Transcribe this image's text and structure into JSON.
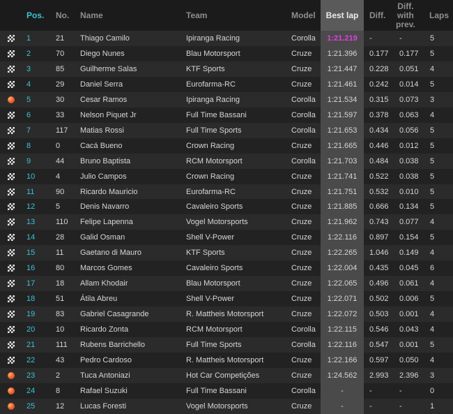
{
  "headers": {
    "pos": "Pos.",
    "no": "No.",
    "name": "Name",
    "team": "Team",
    "model": "Model",
    "best": "Best lap",
    "diff": "Diff.",
    "diffprev": "Diff.\nwith\nprev.",
    "laps": "Laps"
  },
  "colors": {
    "accent": "#3dc1d6",
    "fastest": "#e23fe0",
    "pit": "#f0672a"
  },
  "rows": [
    {
      "status": "flag-icon",
      "pos": "1",
      "no": "21",
      "name": "Thiago Camilo",
      "team": "Ipiranga Racing",
      "model": "Corolla",
      "best": "1:21.219",
      "diff": "-",
      "prev": "-",
      "laps": "5",
      "fastest": true
    },
    {
      "status": "flag-icon",
      "pos": "2",
      "no": "70",
      "name": "Diego Nunes",
      "team": "Blau Motorsport",
      "model": "Cruze",
      "best": "1:21.396",
      "diff": "0.177",
      "prev": "0.177",
      "laps": "5"
    },
    {
      "status": "flag-icon",
      "pos": "3",
      "no": "85",
      "name": "Guilherme Salas",
      "team": "KTF Sports",
      "model": "Cruze",
      "best": "1:21.447",
      "diff": "0.228",
      "prev": "0.051",
      "laps": "4"
    },
    {
      "status": "flag-icon",
      "pos": "4",
      "no": "29",
      "name": "Daniel Serra",
      "team": "Eurofarma-RC",
      "model": "Cruze",
      "best": "1:21.461",
      "diff": "0.242",
      "prev": "0.014",
      "laps": "5"
    },
    {
      "status": "pit-icon",
      "pos": "5",
      "no": "30",
      "name": "Cesar Ramos",
      "team": "Ipiranga Racing",
      "model": "Corolla",
      "best": "1:21.534",
      "diff": "0.315",
      "prev": "0.073",
      "laps": "3"
    },
    {
      "status": "flag-icon",
      "pos": "6",
      "no": "33",
      "name": "Nelson Piquet Jr",
      "team": "Full Time Bassani",
      "model": "Corolla",
      "best": "1:21.597",
      "diff": "0.378",
      "prev": "0.063",
      "laps": "4"
    },
    {
      "status": "flag-icon",
      "pos": "7",
      "no": "117",
      "name": "Matias Rossi",
      "team": "Full Time Sports",
      "model": "Corolla",
      "best": "1:21.653",
      "diff": "0.434",
      "prev": "0.056",
      "laps": "5"
    },
    {
      "status": "flag-icon",
      "pos": "8",
      "no": "0",
      "name": "Cacá Bueno",
      "team": "Crown Racing",
      "model": "Cruze",
      "best": "1:21.665",
      "diff": "0.446",
      "prev": "0.012",
      "laps": "5"
    },
    {
      "status": "flag-icon",
      "pos": "9",
      "no": "44",
      "name": "Bruno Baptista",
      "team": "RCM Motorsport",
      "model": "Corolla",
      "best": "1:21.703",
      "diff": "0.484",
      "prev": "0.038",
      "laps": "5"
    },
    {
      "status": "flag-icon",
      "pos": "10",
      "no": "4",
      "name": "Julio Campos",
      "team": "Crown Racing",
      "model": "Cruze",
      "best": "1:21.741",
      "diff": "0.522",
      "prev": "0.038",
      "laps": "5"
    },
    {
      "status": "flag-icon",
      "pos": "11",
      "no": "90",
      "name": "Ricardo Mauricio",
      "team": "Eurofarma-RC",
      "model": "Cruze",
      "best": "1:21.751",
      "diff": "0.532",
      "prev": "0.010",
      "laps": "5"
    },
    {
      "status": "flag-icon",
      "pos": "12",
      "no": "5",
      "name": "Denis Navarro",
      "team": "Cavaleiro Sports",
      "model": "Cruze",
      "best": "1:21.885",
      "diff": "0.666",
      "prev": "0.134",
      "laps": "5"
    },
    {
      "status": "flag-icon",
      "pos": "13",
      "no": "110",
      "name": "Felipe Lapenna",
      "team": "Vogel Motorsports",
      "model": "Cruze",
      "best": "1:21.962",
      "diff": "0.743",
      "prev": "0.077",
      "laps": "4"
    },
    {
      "status": "flag-icon",
      "pos": "14",
      "no": "28",
      "name": "Galid Osman",
      "team": "Shell V-Power",
      "model": "Cruze",
      "best": "1:22.116",
      "diff": "0.897",
      "prev": "0.154",
      "laps": "5"
    },
    {
      "status": "flag-icon",
      "pos": "15",
      "no": "11",
      "name": "Gaetano di Mauro",
      "team": "KTF Sports",
      "model": "Cruze",
      "best": "1:22.265",
      "diff": "1.046",
      "prev": "0.149",
      "laps": "4"
    },
    {
      "status": "flag-icon",
      "pos": "16",
      "no": "80",
      "name": "Marcos Gomes",
      "team": "Cavaleiro Sports",
      "model": "Cruze",
      "best": "1:22.004",
      "diff": "0.435",
      "prev": "0.045",
      "laps": "6"
    },
    {
      "status": "flag-icon",
      "pos": "17",
      "no": "18",
      "name": "Allam Khodair",
      "team": "Blau Motorsport",
      "model": "Cruze",
      "best": "1:22.065",
      "diff": "0.496",
      "prev": "0.061",
      "laps": "4"
    },
    {
      "status": "flag-icon",
      "pos": "18",
      "no": "51",
      "name": "Átila Abreu",
      "team": "Shell V-Power",
      "model": "Cruze",
      "best": "1:22.071",
      "diff": "0.502",
      "prev": "0.006",
      "laps": "5"
    },
    {
      "status": "flag-icon",
      "pos": "19",
      "no": "83",
      "name": "Gabriel Casagrande",
      "team": "R. Mattheis Motorsport",
      "model": "Cruze",
      "best": "1:22.072",
      "diff": "0.503",
      "prev": "0.001",
      "laps": "4"
    },
    {
      "status": "flag-icon",
      "pos": "20",
      "no": "10",
      "name": "Ricardo Zonta",
      "team": "RCM Motorsport",
      "model": "Corolla",
      "best": "1:22.115",
      "diff": "0.546",
      "prev": "0.043",
      "laps": "4"
    },
    {
      "status": "flag-icon",
      "pos": "21",
      "no": "111",
      "name": "Rubens Barrichello",
      "team": "Full Time Sports",
      "model": "Corolla",
      "best": "1:22.116",
      "diff": "0.547",
      "prev": "0.001",
      "laps": "5"
    },
    {
      "status": "flag-icon",
      "pos": "22",
      "no": "43",
      "name": "Pedro Cardoso",
      "team": "R. Mattheis Motorsport",
      "model": "Cruze",
      "best": "1:22.166",
      "diff": "0.597",
      "prev": "0.050",
      "laps": "4"
    },
    {
      "status": "pit-icon",
      "pos": "23",
      "no": "2",
      "name": "Tuca Antoniazi",
      "team": "Hot Car Competições",
      "model": "Cruze",
      "best": "1:24.562",
      "diff": "2.993",
      "prev": "2.396",
      "laps": "3"
    },
    {
      "status": "pit-icon",
      "pos": "24",
      "no": "8",
      "name": "Rafael Suzuki",
      "team": "Full Time Bassani",
      "model": "Corolla",
      "best": "-",
      "diff": "-",
      "prev": "-",
      "laps": "0"
    },
    {
      "status": "pit-icon",
      "pos": "25",
      "no": "12",
      "name": "Lucas Foresti",
      "team": "Vogel Motorsports",
      "model": "Cruze",
      "best": "-",
      "diff": "-",
      "prev": "-",
      "laps": "1"
    }
  ]
}
